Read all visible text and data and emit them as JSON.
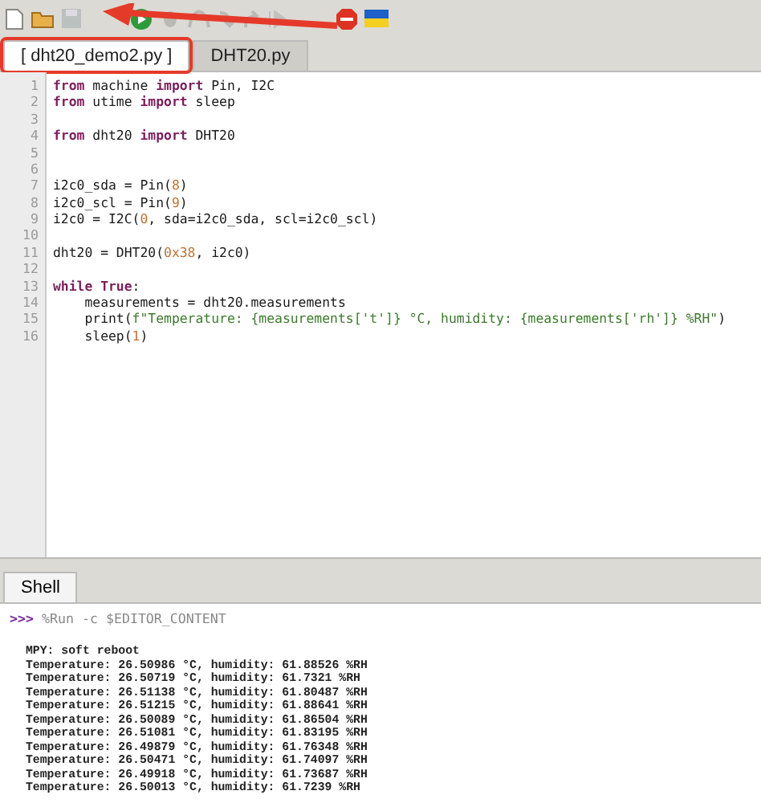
{
  "toolbar": [
    {
      "kind": "new",
      "disabled": false
    },
    {
      "kind": "open",
      "disabled": false
    },
    {
      "kind": "save",
      "disabled": true
    },
    {
      "kind": "run",
      "disabled": false
    },
    {
      "kind": "debug",
      "disabled": true
    },
    {
      "kind": "step-over",
      "disabled": true
    },
    {
      "kind": "step-into",
      "disabled": true
    },
    {
      "kind": "step-out",
      "disabled": true
    },
    {
      "kind": "resume",
      "disabled": true
    },
    {
      "kind": "stop",
      "disabled": false
    },
    {
      "kind": "flag",
      "disabled": false
    }
  ],
  "editor_tabs": [
    {
      "label": "[ dht20_demo2.py ]",
      "selected": true,
      "highlighted": true
    },
    {
      "label": "DHT20.py",
      "selected": false,
      "highlighted": false
    }
  ],
  "code_lines": [
    {
      "number": "1",
      "tokens": [
        {
          "kind": "keyword",
          "text": "from"
        },
        {
          "kind": "plain",
          "text": " machine "
        },
        {
          "kind": "keyword",
          "text": "import"
        },
        {
          "kind": "plain",
          "text": " Pin, I2C"
        }
      ]
    },
    {
      "number": "2",
      "tokens": [
        {
          "kind": "keyword",
          "text": "from"
        },
        {
          "kind": "plain",
          "text": " utime "
        },
        {
          "kind": "keyword",
          "text": "import"
        },
        {
          "kind": "plain",
          "text": " sleep"
        }
      ]
    },
    {
      "number": "3"
    },
    {
      "number": "4",
      "tokens": [
        {
          "kind": "keyword",
          "text": "from"
        },
        {
          "kind": "plain",
          "text": " dht20 "
        },
        {
          "kind": "keyword",
          "text": "import"
        },
        {
          "kind": "plain",
          "text": " DHT20"
        }
      ]
    },
    {
      "number": "5"
    },
    {
      "number": "6"
    },
    {
      "number": "7",
      "tokens": [
        {
          "kind": "plain",
          "text": "i2c0_sda = Pin("
        },
        {
          "kind": "number",
          "text": "8"
        },
        {
          "kind": "plain",
          "text": ")"
        }
      ]
    },
    {
      "number": "8",
      "tokens": [
        {
          "kind": "plain",
          "text": "i2c0_scl = Pin("
        },
        {
          "kind": "number",
          "text": "9"
        },
        {
          "kind": "plain",
          "text": ")"
        }
      ]
    },
    {
      "number": "9",
      "tokens": [
        {
          "kind": "plain",
          "text": "i2c0 = I2C("
        },
        {
          "kind": "number",
          "text": "0"
        },
        {
          "kind": "plain",
          "text": ", sda=i2c0_sda, scl=i2c0_scl)"
        }
      ]
    },
    {
      "number": "10"
    },
    {
      "number": "11",
      "tokens": [
        {
          "kind": "plain",
          "text": "dht20 = DHT20("
        },
        {
          "kind": "number",
          "text": "0x38"
        },
        {
          "kind": "plain",
          "text": ", i2c0)"
        }
      ]
    },
    {
      "number": "12"
    },
    {
      "number": "13",
      "tokens": [
        {
          "kind": "keyword",
          "text": "while True"
        },
        {
          "kind": "plain",
          "text": ":"
        }
      ]
    },
    {
      "number": "14",
      "tokens": [
        {
          "kind": "plain",
          "text": "    measurements = dht20.measurements"
        }
      ]
    },
    {
      "number": "15",
      "tokens": [
        {
          "kind": "plain",
          "text": "    print("
        },
        {
          "kind": "string",
          "text": "f\"Temperature: {measurements['t']} °C, humidity: {measurements['rh']} %RH\""
        },
        {
          "kind": "plain",
          "text": ")"
        }
      ]
    },
    {
      "number": "16",
      "tokens": [
        {
          "kind": "plain",
          "text": "    sleep("
        },
        {
          "kind": "number",
          "text": "1"
        },
        {
          "kind": "plain",
          "text": ")"
        }
      ]
    }
  ],
  "shell": {
    "tab": {
      "label": "Shell",
      "selected": true
    },
    "prompt": ">>>",
    "command": "%Run -c $EDITOR_CONTENT",
    "output": [
      "MPY: soft reboot",
      "Temperature: 26.50986 °C, humidity: 61.88526 %RH",
      "Temperature: 26.50719 °C, humidity: 61.7321 %RH",
      "Temperature: 26.51138 °C, humidity: 61.80487 %RH",
      "Temperature: 26.51215 °C, humidity: 61.88641 %RH",
      "Temperature: 26.50089 °C, humidity: 61.86504 %RH",
      "Temperature: 26.51081 °C, humidity: 61.83195 %RH",
      "Temperature: 26.49879 °C, humidity: 61.76348 %RH",
      "Temperature: 26.50471 °C, humidity: 61.74097 %RH",
      "Temperature: 26.49918 °C, humidity: 61.73687 %RH",
      "Temperature: 26.50013 °C, humidity: 61.7239 %RH"
    ]
  }
}
